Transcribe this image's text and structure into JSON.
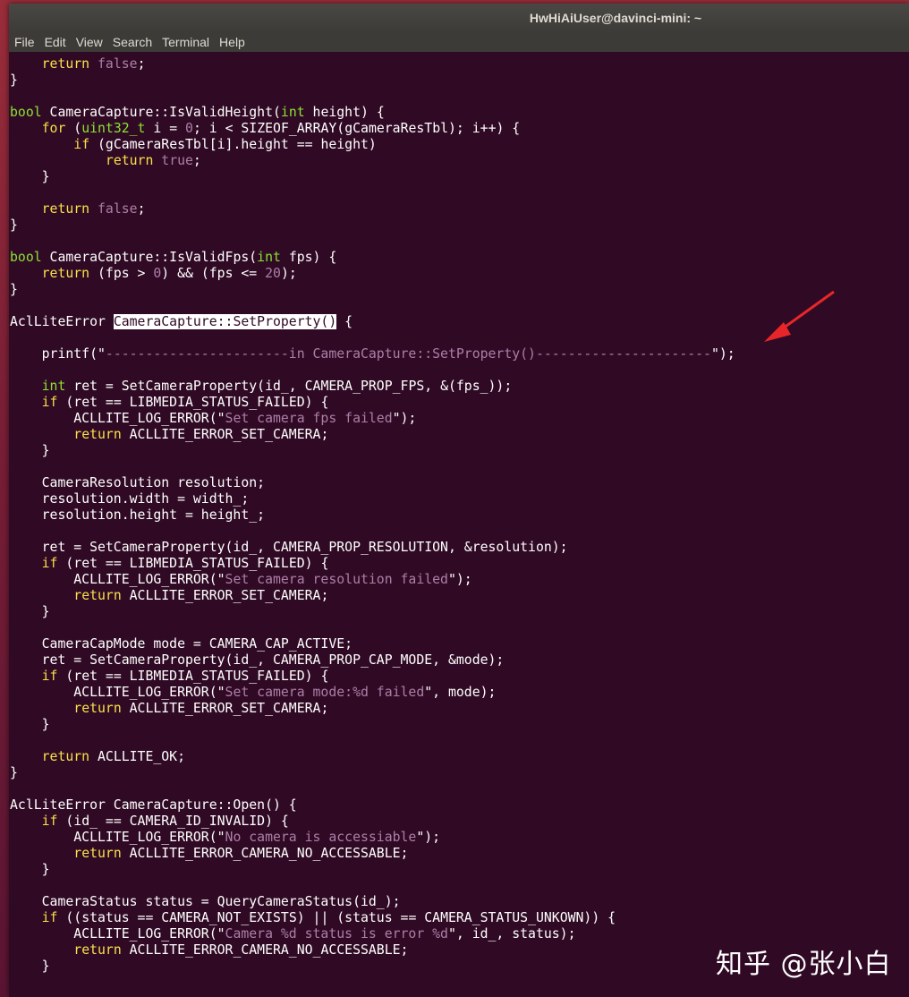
{
  "window": {
    "title": "HwHiAiUser@davinci-mini: ~"
  },
  "menu": [
    "File",
    "Edit",
    "View",
    "Search",
    "Terminal",
    "Help"
  ],
  "code_lines": [
    [
      [
        "    ",
        ""
      ],
      [
        "return",
        "kw"
      ],
      [
        " ",
        ""
      ],
      [
        "false",
        "st"
      ],
      [
        ";",
        ""
      ]
    ],
    [
      [
        "}",
        ""
      ]
    ],
    [],
    [
      [
        "bool",
        "ty"
      ],
      [
        " CameraCapture::IsValidHeight(",
        ""
      ],
      [
        "int",
        "ty"
      ],
      [
        " height) {",
        ""
      ]
    ],
    [
      [
        "    ",
        ""
      ],
      [
        "for",
        "kw"
      ],
      [
        " (",
        ""
      ],
      [
        "uint32_t",
        "ty"
      ],
      [
        " i = ",
        ""
      ],
      [
        "0",
        "nm"
      ],
      [
        "; i < SIZEOF_ARRAY(gCameraResTbl); i++) {",
        ""
      ]
    ],
    [
      [
        "        ",
        ""
      ],
      [
        "if",
        "kw"
      ],
      [
        " (gCameraResTbl[i].height == height)",
        ""
      ]
    ],
    [
      [
        "            ",
        ""
      ],
      [
        "return",
        "kw"
      ],
      [
        " ",
        ""
      ],
      [
        "true",
        "st"
      ],
      [
        ";",
        ""
      ]
    ],
    [
      [
        "    }",
        ""
      ]
    ],
    [],
    [
      [
        "    ",
        ""
      ],
      [
        "return",
        "kw"
      ],
      [
        " ",
        ""
      ],
      [
        "false",
        "st"
      ],
      [
        ";",
        ""
      ]
    ],
    [
      [
        "}",
        ""
      ]
    ],
    [],
    [
      [
        "bool",
        "ty"
      ],
      [
        " CameraCapture::IsValidFps(",
        ""
      ],
      [
        "int",
        "ty"
      ],
      [
        " fps) {",
        ""
      ]
    ],
    [
      [
        "    ",
        ""
      ],
      [
        "return",
        "kw"
      ],
      [
        " (fps > ",
        ""
      ],
      [
        "0",
        "nm"
      ],
      [
        ") && (fps <= ",
        ""
      ],
      [
        "20",
        "nm"
      ],
      [
        ");",
        ""
      ]
    ],
    [
      [
        "}",
        ""
      ]
    ],
    [],
    [
      [
        "AclLiteError ",
        ""
      ],
      [
        "CameraCapture::SetProperty()",
        "sel"
      ],
      [
        " {",
        ""
      ]
    ],
    [],
    [
      [
        "    printf(\"",
        ""
      ],
      [
        "-----------------------in CameraCapture::SetProperty()----------------------",
        "st"
      ],
      [
        "\");",
        ""
      ]
    ],
    [],
    [
      [
        "    ",
        ""
      ],
      [
        "int",
        "ty"
      ],
      [
        " ret = SetCameraProperty(id_, CAMERA_PROP_FPS, &(fps_));",
        ""
      ]
    ],
    [
      [
        "    ",
        ""
      ],
      [
        "if",
        "kw"
      ],
      [
        " (ret == LIBMEDIA_STATUS_FAILED) {",
        ""
      ]
    ],
    [
      [
        "        ACLLITE_LOG_ERROR(\"",
        ""
      ],
      [
        "Set camera fps failed",
        "st"
      ],
      [
        "\");",
        ""
      ]
    ],
    [
      [
        "        ",
        ""
      ],
      [
        "return",
        "kw"
      ],
      [
        " ACLLITE_ERROR_SET_CAMERA;",
        ""
      ]
    ],
    [
      [
        "    }",
        ""
      ]
    ],
    [],
    [
      [
        "    CameraResolution resolution;",
        ""
      ]
    ],
    [
      [
        "    resolution.width = width_;",
        ""
      ]
    ],
    [
      [
        "    resolution.height = height_;",
        ""
      ]
    ],
    [],
    [
      [
        "    ret = SetCameraProperty(id_, CAMERA_PROP_RESOLUTION, &resolution);",
        ""
      ]
    ],
    [
      [
        "    ",
        ""
      ],
      [
        "if",
        "kw"
      ],
      [
        " (ret == LIBMEDIA_STATUS_FAILED) {",
        ""
      ]
    ],
    [
      [
        "        ACLLITE_LOG_ERROR(\"",
        ""
      ],
      [
        "Set camera resolution failed",
        "st"
      ],
      [
        "\");",
        ""
      ]
    ],
    [
      [
        "        ",
        ""
      ],
      [
        "return",
        "kw"
      ],
      [
        " ACLLITE_ERROR_SET_CAMERA;",
        ""
      ]
    ],
    [
      [
        "    }",
        ""
      ]
    ],
    [],
    [
      [
        "    CameraCapMode mode = CAMERA_CAP_ACTIVE;",
        ""
      ]
    ],
    [
      [
        "    ret = SetCameraProperty(id_, CAMERA_PROP_CAP_MODE, &mode);",
        ""
      ]
    ],
    [
      [
        "    ",
        ""
      ],
      [
        "if",
        "kw"
      ],
      [
        " (ret == LIBMEDIA_STATUS_FAILED) {",
        ""
      ]
    ],
    [
      [
        "        ACLLITE_LOG_ERROR(\"",
        ""
      ],
      [
        "Set camera mode:%d failed",
        "st"
      ],
      [
        "\", mode);",
        ""
      ]
    ],
    [
      [
        "        ",
        ""
      ],
      [
        "return",
        "kw"
      ],
      [
        " ACLLITE_ERROR_SET_CAMERA;",
        ""
      ]
    ],
    [
      [
        "    }",
        ""
      ]
    ],
    [],
    [
      [
        "    ",
        ""
      ],
      [
        "return",
        "kw"
      ],
      [
        " ACLLITE_OK;",
        ""
      ]
    ],
    [
      [
        "}",
        ""
      ]
    ],
    [],
    [
      [
        "AclLiteError CameraCapture::Open() {",
        ""
      ]
    ],
    [
      [
        "    ",
        ""
      ],
      [
        "if",
        "kw"
      ],
      [
        " (id_ == CAMERA_ID_INVALID) {",
        ""
      ]
    ],
    [
      [
        "        ACLLITE_LOG_ERROR(\"",
        ""
      ],
      [
        "No camera is accessiable",
        "st"
      ],
      [
        "\");",
        ""
      ]
    ],
    [
      [
        "        ",
        ""
      ],
      [
        "return",
        "kw"
      ],
      [
        " ACLLITE_ERROR_CAMERA_NO_ACCESSABLE;",
        ""
      ]
    ],
    [
      [
        "    }",
        ""
      ]
    ],
    [],
    [
      [
        "    CameraStatus status = QueryCameraStatus(id_);",
        ""
      ]
    ],
    [
      [
        "    ",
        ""
      ],
      [
        "if",
        "kw"
      ],
      [
        " ((status == CAMERA_NOT_EXISTS) || (status == CAMERA_STATUS_UNKOWN)) {",
        ""
      ]
    ],
    [
      [
        "        ACLLITE_LOG_ERROR(\"",
        ""
      ],
      [
        "Camera %d status is error %d",
        "st"
      ],
      [
        "\", id_, status);",
        ""
      ]
    ],
    [
      [
        "        ",
        ""
      ],
      [
        "return",
        "kw"
      ],
      [
        " ACLLITE_ERROR_CAMERA_NO_ACCESSABLE;",
        ""
      ]
    ],
    [
      [
        "    }",
        ""
      ]
    ]
  ],
  "watermark": "知乎 @张小白",
  "colors": {
    "terminal_bg": "#300a24",
    "keyword": "#f8e04a",
    "type": "#8ae234",
    "string": "#ad7fa8",
    "arrow": "#e8262a"
  }
}
